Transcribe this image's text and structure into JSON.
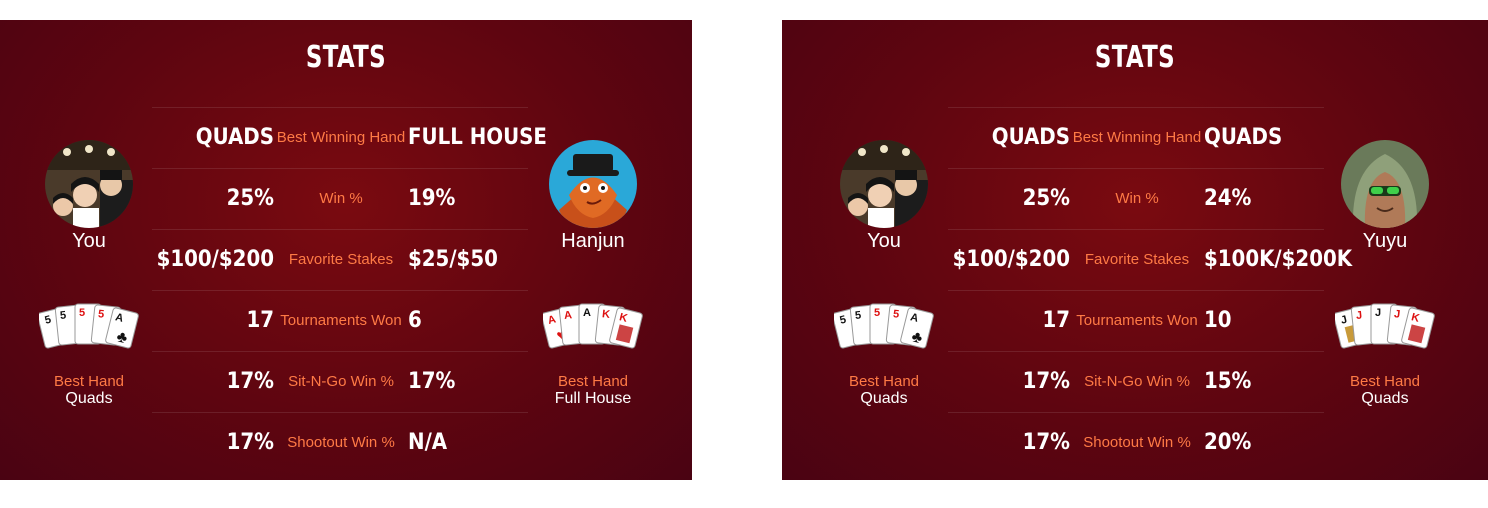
{
  "panels": [
    {
      "title": "STATS",
      "left_player": {
        "name": "You"
      },
      "right_player": {
        "name": "Hanjun"
      },
      "left_best_hand": {
        "label": "Best Hand",
        "value": "Quads"
      },
      "right_best_hand": {
        "label": "Best Hand",
        "value": "Full House"
      },
      "rows": [
        {
          "left": "QUADS",
          "label": "Best Winning Hand",
          "right": "FULL HOUSE"
        },
        {
          "left": "25%",
          "label": "Win %",
          "right": "19%"
        },
        {
          "left": "$100/$200",
          "label": "Favorite Stakes",
          "right": "$25/$50"
        },
        {
          "left": "17",
          "label": "Tournaments Won",
          "right": "6"
        },
        {
          "left": "17%",
          "label": "Sit-N-Go Win %",
          "right": "17%"
        },
        {
          "left": "17%",
          "label": "Shootout Win %",
          "right": "N/A"
        }
      ],
      "left_cards": [
        "5",
        "5",
        "5",
        "5",
        "A"
      ],
      "right_cards": [
        "A",
        "A",
        "A",
        "K",
        "K"
      ]
    },
    {
      "title": "STATS",
      "left_player": {
        "name": "You"
      },
      "right_player": {
        "name": "Yuyu"
      },
      "left_best_hand": {
        "label": "Best Hand",
        "value": "Quads"
      },
      "right_best_hand": {
        "label": "Best Hand",
        "value": "Quads"
      },
      "rows": [
        {
          "left": "QUADS",
          "label": "Best Winning Hand",
          "right": "QUADS"
        },
        {
          "left": "25%",
          "label": "Win %",
          "right": "24%"
        },
        {
          "left": "$100/$200",
          "label": "Favorite Stakes",
          "right": "$100K/$200K"
        },
        {
          "left": "17",
          "label": "Tournaments Won",
          "right": "10"
        },
        {
          "left": "17%",
          "label": "Sit-N-Go Win %",
          "right": "15%"
        },
        {
          "left": "17%",
          "label": "Shootout Win %",
          "right": "20%"
        }
      ],
      "left_cards": [
        "5",
        "5",
        "5",
        "5",
        "A"
      ],
      "right_cards": [
        "J",
        "J",
        "J",
        "J",
        "K"
      ]
    }
  ]
}
